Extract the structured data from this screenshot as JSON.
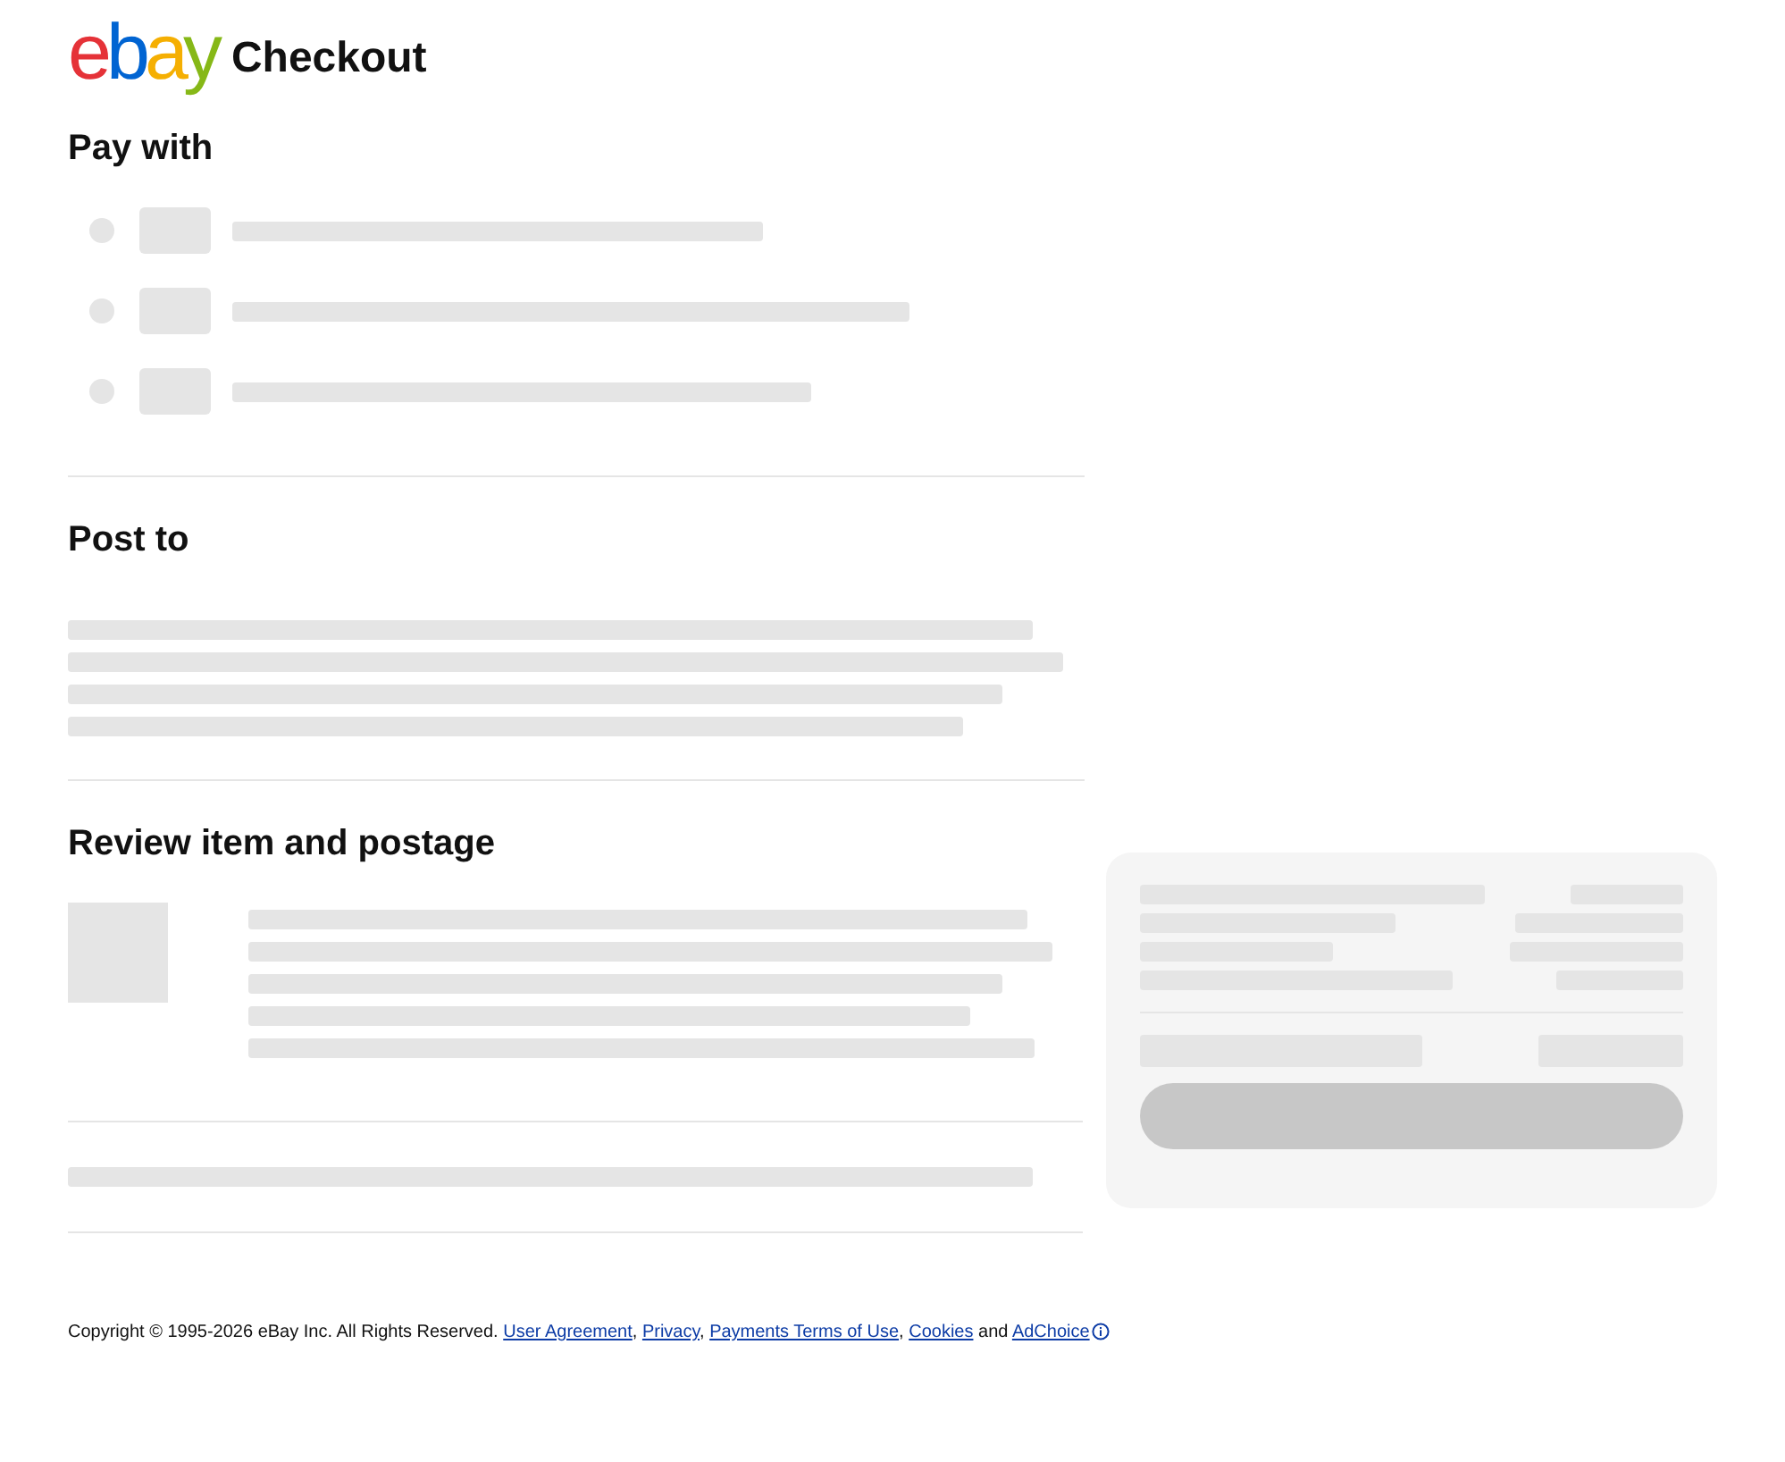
{
  "header": {
    "logo_letters": [
      {
        "text": "e",
        "color": "#e53238"
      },
      {
        "text": "b",
        "color": "#0064d2"
      },
      {
        "text": "a",
        "color": "#f5af02"
      },
      {
        "text": "y",
        "color": "#86b817"
      }
    ],
    "title": "Checkout"
  },
  "sections": [
    {
      "kind": "payment",
      "heading": "Pay with"
    },
    {
      "kind": "address",
      "heading": "Post to"
    },
    {
      "kind": "review",
      "heading": "Review item and postage"
    }
  ],
  "footer": {
    "copyright": "Copyright © 1995-2026 eBay Inc. All Rights Reserved.",
    "links": [
      {
        "text": "User Agreement",
        "after": ","
      },
      {
        "text": "Privacy",
        "after": ","
      },
      {
        "text": "Payments Terms of Use",
        "after": ","
      },
      {
        "text": "Cookies",
        "after": " and"
      },
      {
        "text": "AdChoice"
      }
    ]
  }
}
